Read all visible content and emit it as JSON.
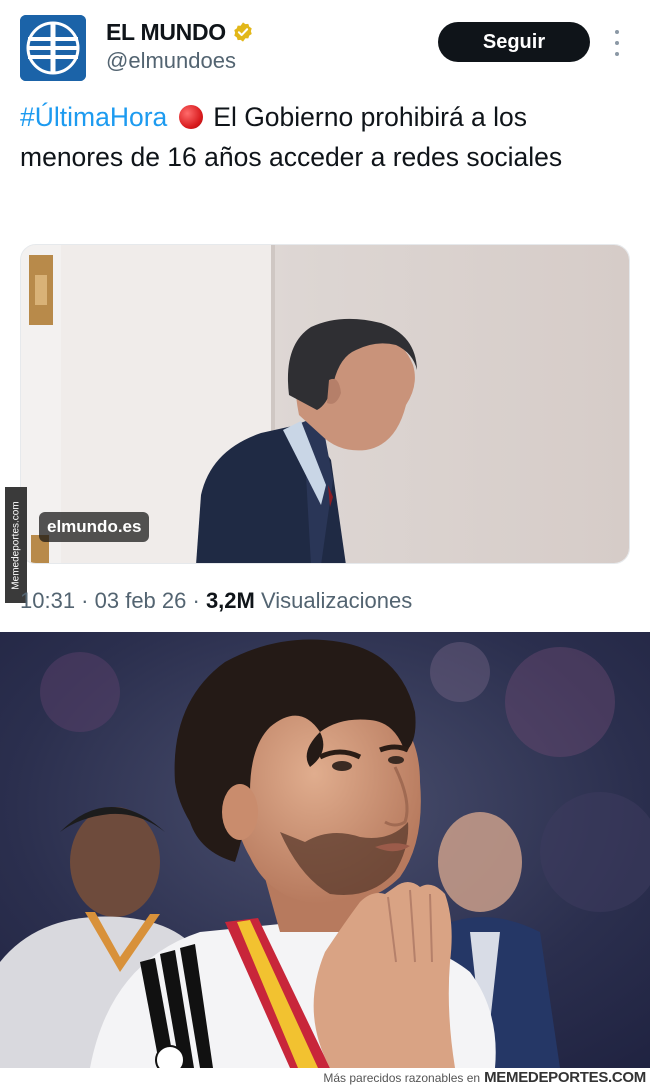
{
  "header": {
    "name": "EL MUNDO",
    "handle": "@elmundoes",
    "follow_label": "Seguir",
    "avatar_icon": "el-mundo-globe-logo",
    "verified_icon": "gold-verified-badge",
    "verified_color": "#e2b719"
  },
  "tweet": {
    "hashtag": "#ÚltimaHora",
    "emoji": "red-circle",
    "text": "El Gobierno prohibirá a los menores de 16 años acceder a redes sociales",
    "media_source": "elmundo.es"
  },
  "meta": {
    "time": "10:31",
    "date": "03 feb 26",
    "views_count": "3,2M",
    "views_label": "Visualizaciones"
  },
  "watermark": {
    "side_text": "Memedeportes.com",
    "footer_text": "Más parecidos razonables en",
    "footer_brand": "MEMEDEPORTES.COM"
  },
  "colors": {
    "accent": "#1d9bf0",
    "text": "#0f1419",
    "secondary": "#536471",
    "button": "#0f1419"
  }
}
